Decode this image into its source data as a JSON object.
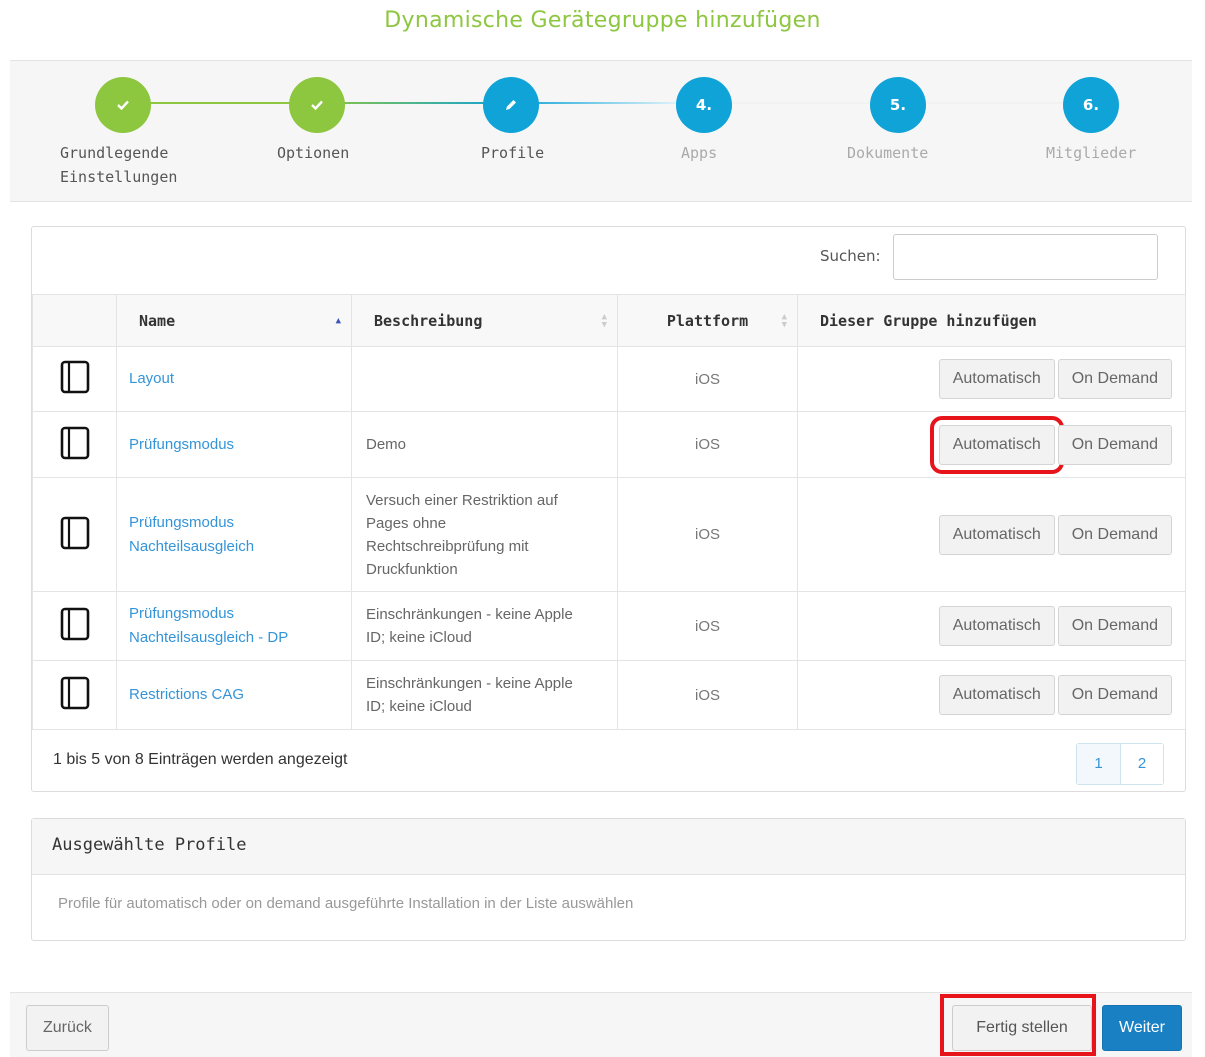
{
  "page": {
    "title": "Dynamische Gerätegruppe hinzufügen"
  },
  "wizard": {
    "steps": [
      {
        "state": "done",
        "marker": "",
        "label_line1": "Grundlegende",
        "label_line2": "Einstellungen"
      },
      {
        "state": "done",
        "marker": "",
        "label_line1": "Optionen",
        "label_line2": ""
      },
      {
        "state": "active",
        "marker": "",
        "label_line1": "Profile",
        "label_line2": ""
      },
      {
        "state": "todo",
        "marker": "4.",
        "label_line1": "Apps",
        "label_line2": ""
      },
      {
        "state": "todo",
        "marker": "5.",
        "label_line1": "Dokumente",
        "label_line2": ""
      },
      {
        "state": "todo",
        "marker": "6.",
        "label_line1": "Mitglieder",
        "label_line2": ""
      }
    ],
    "colors": {
      "done": "#8dc63f",
      "active": "#0fa3d8"
    }
  },
  "search": {
    "label": "Suchen:",
    "value": "",
    "placeholder": ""
  },
  "table": {
    "columns": {
      "name": "Name",
      "description": "Beschreibung",
      "platform": "Plattform",
      "add": "Dieser Gruppe hinzufügen"
    },
    "rows": [
      {
        "icon": "tablet-icon",
        "name_line1": "Layout",
        "name_line2": "",
        "desc": [
          "",
          "",
          "",
          ""
        ],
        "platform": "iOS",
        "btn_auto": "Automatisch",
        "btn_demand": "On Demand"
      },
      {
        "icon": "tablet-icon",
        "name_line1": "Prüfungsmodus",
        "name_line2": "",
        "desc": [
          "Demo",
          "",
          "",
          ""
        ],
        "platform": "iOS",
        "btn_auto": "Automatisch",
        "btn_demand": "On Demand"
      },
      {
        "icon": "tablet-icon",
        "name_line1": "Prüfungsmodus",
        "name_line2": "Nachteilsausgleich",
        "desc": [
          "Versuch einer Restriktion auf",
          "Pages ohne",
          "Rechtschreibprüfung mit",
          "Druckfunktion"
        ],
        "platform": "iOS",
        "btn_auto": "Automatisch",
        "btn_demand": "On Demand"
      },
      {
        "icon": "tablet-icon",
        "name_line1": "Prüfungsmodus",
        "name_line2": "Nachteilsausgleich - DP",
        "desc": [
          "Einschränkungen - keine Apple",
          "ID; keine iCloud",
          "",
          ""
        ],
        "platform": "iOS",
        "btn_auto": "Automatisch",
        "btn_demand": "On Demand"
      },
      {
        "icon": "tablet-icon",
        "name_line1": "Restrictions CAG",
        "name_line2": "",
        "desc": [
          "Einschränkungen - keine Apple",
          "ID; keine iCloud",
          "",
          ""
        ],
        "platform": "iOS",
        "btn_auto": "Automatisch",
        "btn_demand": "On Demand"
      }
    ],
    "info": "1 bis 5 von 8 Einträgen werden angezeigt",
    "pages": [
      "1",
      "2"
    ],
    "current_page": "1"
  },
  "selected_panel": {
    "title": "Ausgewählte Profile",
    "hint": "Profile für automatisch oder on demand ausgeführte Installation in der Liste auswählen"
  },
  "footer": {
    "back": "Zurück",
    "finish": "Fertig stellen",
    "next": "Weiter"
  },
  "annotations": {
    "highlight_color": "#e8141c"
  }
}
